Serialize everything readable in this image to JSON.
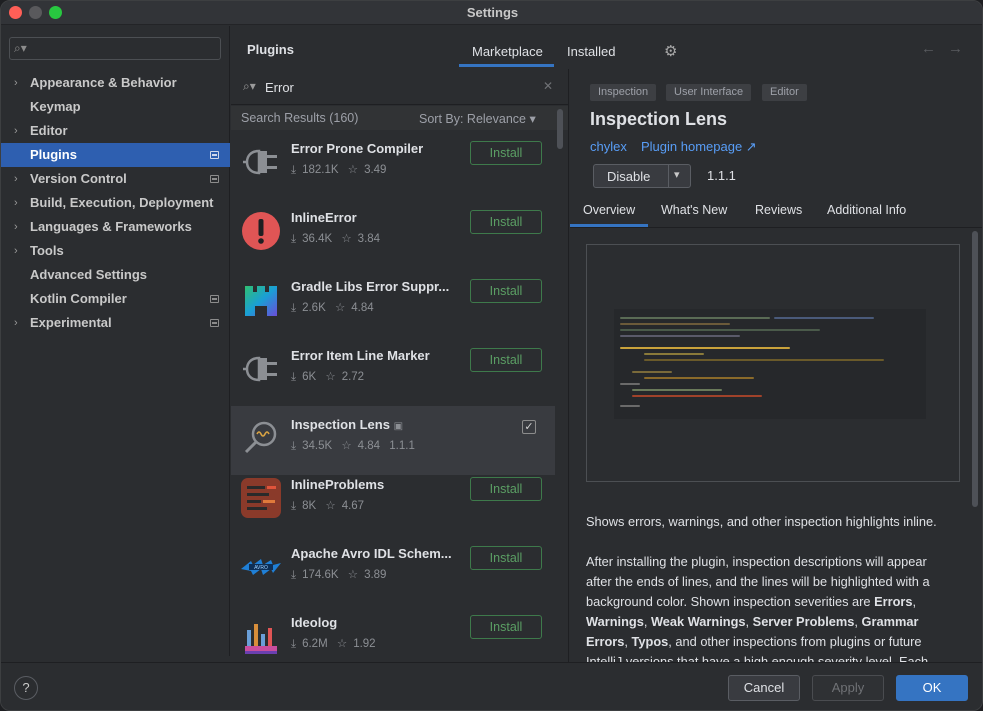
{
  "window": {
    "title": "Settings"
  },
  "sidebar": {
    "search_placeholder": "",
    "items": [
      {
        "label": "Appearance & Behavior",
        "expandable": true,
        "badge": false
      },
      {
        "label": "Keymap",
        "expandable": false,
        "badge": false
      },
      {
        "label": "Editor",
        "expandable": true,
        "badge": false
      },
      {
        "label": "Plugins",
        "expandable": false,
        "badge": true,
        "selected": true
      },
      {
        "label": "Version Control",
        "expandable": true,
        "badge": true
      },
      {
        "label": "Build, Execution, Deployment",
        "expandable": true,
        "badge": false
      },
      {
        "label": "Languages & Frameworks",
        "expandable": true,
        "badge": false
      },
      {
        "label": "Tools",
        "expandable": true,
        "badge": false
      },
      {
        "label": "Advanced Settings",
        "expandable": false,
        "badge": false
      },
      {
        "label": "Kotlin Compiler",
        "expandable": false,
        "badge": true
      },
      {
        "label": "Experimental",
        "expandable": true,
        "badge": true
      }
    ]
  },
  "header": {
    "title": "Plugins",
    "tabs": {
      "marketplace": "Marketplace",
      "installed": "Installed"
    },
    "active_tab": "Marketplace"
  },
  "search": {
    "query": "Error",
    "results_label": "Search Results (160)",
    "sort_label": "Sort By: Relevance"
  },
  "plugins": [
    {
      "name": "Error Prone Compiler",
      "downloads": "182.1K",
      "rating": "3.49",
      "version": "",
      "button": "Install",
      "icon": "plug-icon"
    },
    {
      "name": "InlineError",
      "downloads": "36.4K",
      "rating": "3.84",
      "version": "",
      "button": "Install",
      "icon": "exclamation-icon"
    },
    {
      "name": "Gradle Libs Error Suppr...",
      "downloads": "2.6K",
      "rating": "4.84",
      "version": "",
      "button": "Install",
      "icon": "gradle-icon"
    },
    {
      "name": "Error Item Line Marker",
      "downloads": "6K",
      "rating": "2.72",
      "version": "",
      "button": "Install",
      "icon": "plug-icon"
    },
    {
      "name": "Inspection Lens",
      "downloads": "34.5K",
      "rating": "4.84",
      "version": "1.1.1",
      "button": "",
      "icon": "magnifier-icon",
      "installed": true
    },
    {
      "name": "InlineProblems",
      "downloads": "8K",
      "rating": "4.67",
      "version": "",
      "button": "Install",
      "icon": "lines-icon"
    },
    {
      "name": "Apache Avro IDL Schem...",
      "downloads": "174.6K",
      "rating": "3.89",
      "version": "",
      "button": "Install",
      "icon": "avro-icon"
    },
    {
      "name": "Ideolog",
      "downloads": "6.2M",
      "rating": "1.92",
      "version": "",
      "button": "Install",
      "icon": "ideolog-icon"
    }
  ],
  "detail": {
    "tags": [
      "Inspection",
      "User Interface",
      "Editor"
    ],
    "title": "Inspection Lens",
    "vendor": "chylex",
    "homepage": "Plugin homepage ↗",
    "disable_label": "Disable",
    "version": "1.1.1",
    "tabs": [
      "Overview",
      "What's New",
      "Reviews",
      "Additional Info"
    ],
    "active_tab": "Overview",
    "desc1": "Shows errors, warnings, and other inspection highlights inline.",
    "desc2_lines": [
      "After installing the plugin, inspection descriptions will appear",
      "after the ends of lines, and the lines will be highlighted with a"
    ],
    "desc3_pre": "background color. Shown inspection severities are ",
    "sev_errors": "Errors",
    "sev_warnings": "Warnings",
    "sep1": ", ",
    "sev_weak": "Weak Warnings",
    "sev_server": "Server Problems",
    "sev_grammar": "Grammar",
    "sev_grammar_errors": "Errors",
    "sev_typos": "Typos",
    "desc5_post": ", and other inspections from plugins or future",
    "desc6": "IntelliJ versions that have a high enough severity level. Each"
  },
  "footer": {
    "help": "?",
    "cancel": "Cancel",
    "apply": "Apply",
    "ok": "OK"
  },
  "colors": {
    "accent": "#3574c2",
    "selection": "#2e5fb0",
    "install_green": "#5b9f64",
    "link": "#589df6"
  }
}
